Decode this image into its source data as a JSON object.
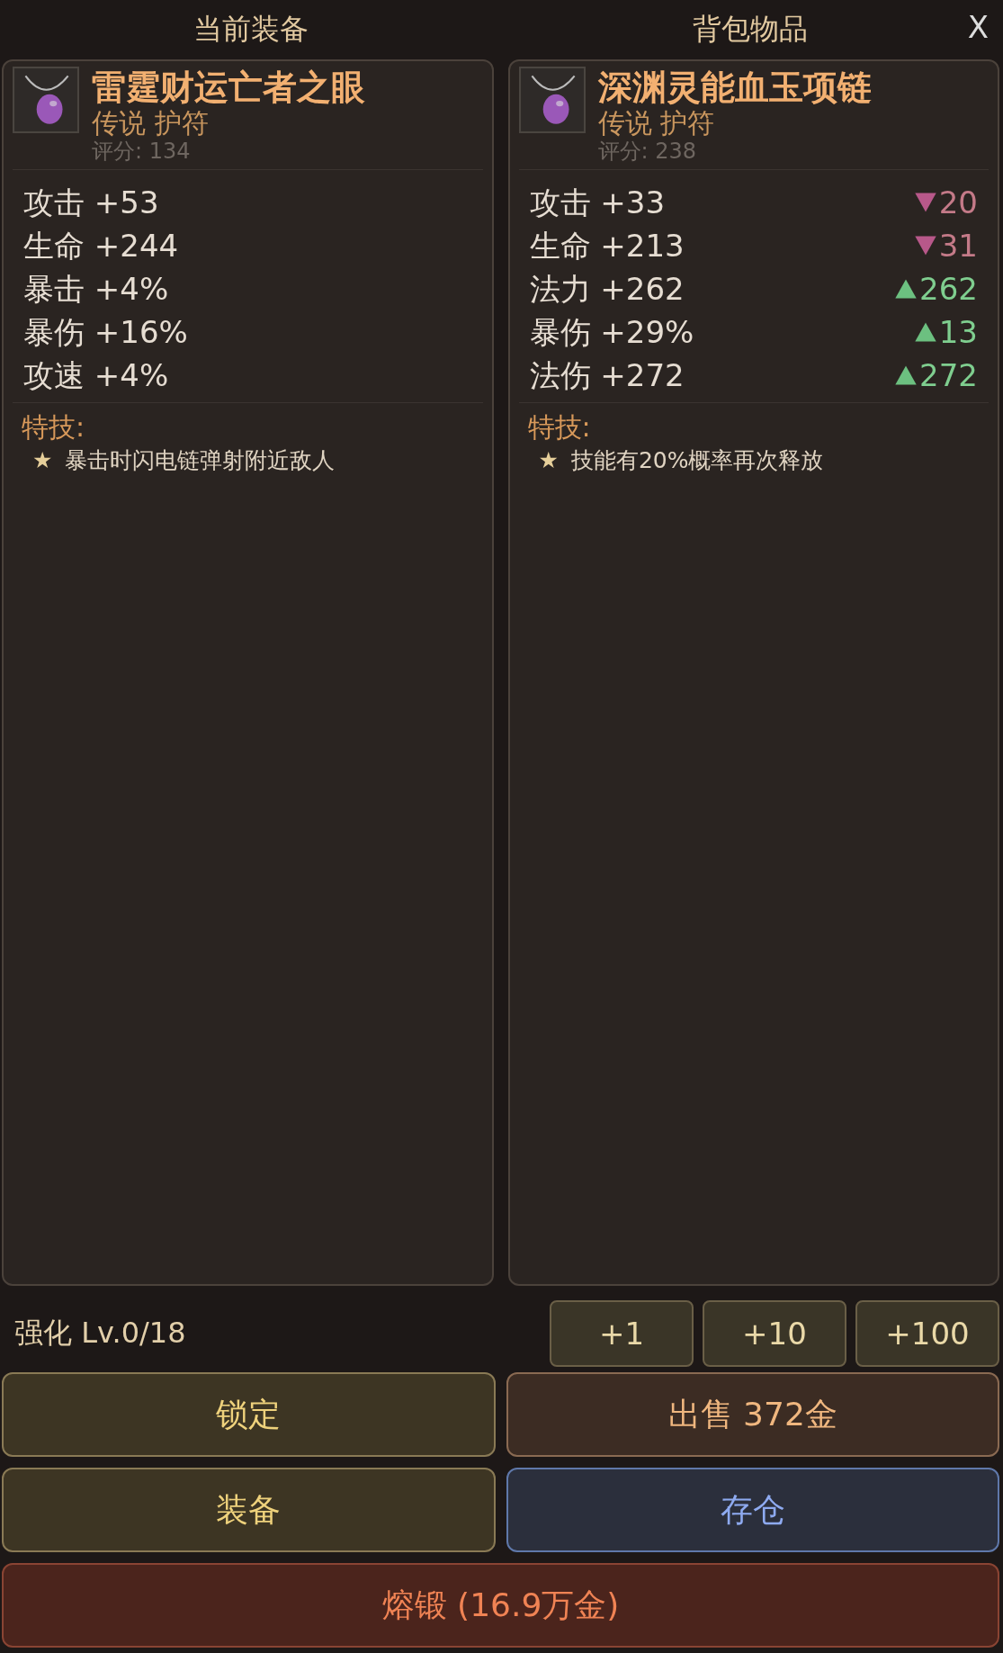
{
  "close_label": "X",
  "panels": [
    {
      "title": "当前装备",
      "item": {
        "name": "雷霆财运亡者之眼",
        "rarity": "传说 护符",
        "score": "评分: 134"
      },
      "stats": [
        {
          "label": "攻击 +53"
        },
        {
          "label": "生命 +244"
        },
        {
          "label": "暴击 +4%"
        },
        {
          "label": "暴伤 +16%"
        },
        {
          "label": "攻速 +4%"
        }
      ],
      "skill_title": "特技:",
      "skills": [
        {
          "star": "★",
          "text": "暴击时闪电链弹射附近敌人"
        }
      ]
    },
    {
      "title": "背包物品",
      "item": {
        "name": "深渊灵能血玉项链",
        "rarity": "传说 护符",
        "score": "评分: 238"
      },
      "stats": [
        {
          "label": "攻击 +33",
          "diff": {
            "kind": "decrease",
            "value": "20"
          }
        },
        {
          "label": "生命 +213",
          "diff": {
            "kind": "decrease",
            "value": "31"
          }
        },
        {
          "label": "法力 +262",
          "diff": {
            "kind": "increase",
            "value": "262"
          }
        },
        {
          "label": "暴伤 +29%",
          "diff": {
            "kind": "increase",
            "value": "13"
          }
        },
        {
          "label": "法伤 +272",
          "diff": {
            "kind": "increase",
            "value": "272"
          }
        }
      ],
      "skill_title": "特技:",
      "skills": [
        {
          "star": "★",
          "text": "技能有20%概率再次释放"
        }
      ]
    }
  ],
  "enhance": {
    "label": "强化 Lv.0/18",
    "steps": [
      "+1",
      "+10",
      "+100"
    ]
  },
  "actions": [
    {
      "label": "锁定",
      "kind": "neutral"
    },
    {
      "label": "出售 372金",
      "kind": "sell"
    },
    {
      "label": "装备",
      "kind": "neutral"
    },
    {
      "label": "存仓",
      "kind": "store"
    },
    {
      "label": "熔锻 (16.9万金)",
      "kind": "melt"
    }
  ]
}
